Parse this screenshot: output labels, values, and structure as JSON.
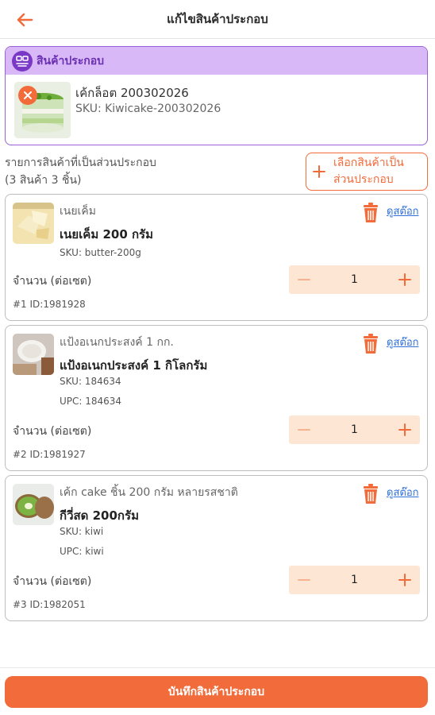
{
  "header": {
    "title": "แก้ไขสินค้าประกอบ",
    "back_icon": "arrow-left-icon"
  },
  "product": {
    "section_label": "สินค้าประกอบ",
    "name": "เค้กล็อต 200302026",
    "sku": "SKU: Kiwicake-200302026"
  },
  "components": {
    "title": "รายการสินค้าที่เป็นส่วนประกอบ",
    "count": "(3 สินค้า 3 ชิ้น)",
    "select_button_line1": "เลือกสินค้าเป็น",
    "select_button_line2": "ส่วนประกอบ",
    "items": [
      {
        "group": "เนยเค็ม",
        "name": "เนยเค็ม 200 กรัม",
        "sku": "SKU: butter-200g",
        "upc": "",
        "stock_link": "ดูสต๊อก",
        "qty_label": "จำนวน (ต่อเซต)",
        "qty": "1",
        "id_label": "#1 ID:1981928"
      },
      {
        "group": "แป้งอเนกประสงค์ 1 กก.",
        "name": "แป้งอเนกประสงค์ 1 กิโลกรัม",
        "sku": "SKU: 184634",
        "upc": "UPC: 184634",
        "stock_link": "ดูสต๊อก",
        "qty_label": "จำนวน (ต่อเซต)",
        "qty": "1",
        "id_label": "#2 ID:1981927"
      },
      {
        "group": "เค้ก cake ชิ้น 200 กรัม หลายรสชาติ",
        "name": "กีวี่สด 200กรัม",
        "sku": "SKU: kiwi",
        "upc": "UPC: kiwi",
        "stock_link": "ดูสต๊อก",
        "qty_label": "จำนวน (ต่อเซต)",
        "qty": "1",
        "id_label": "#3 ID:1982051"
      }
    ]
  },
  "footer": {
    "save_label": "บันทึกสินค้าประกอบ"
  },
  "colors": {
    "accent": "#f26b3a",
    "purple": "#7a38c7",
    "purple_light": "#d9b8f7",
    "stepper_bg": "#fde7d4",
    "link": "#2f6fd6"
  }
}
